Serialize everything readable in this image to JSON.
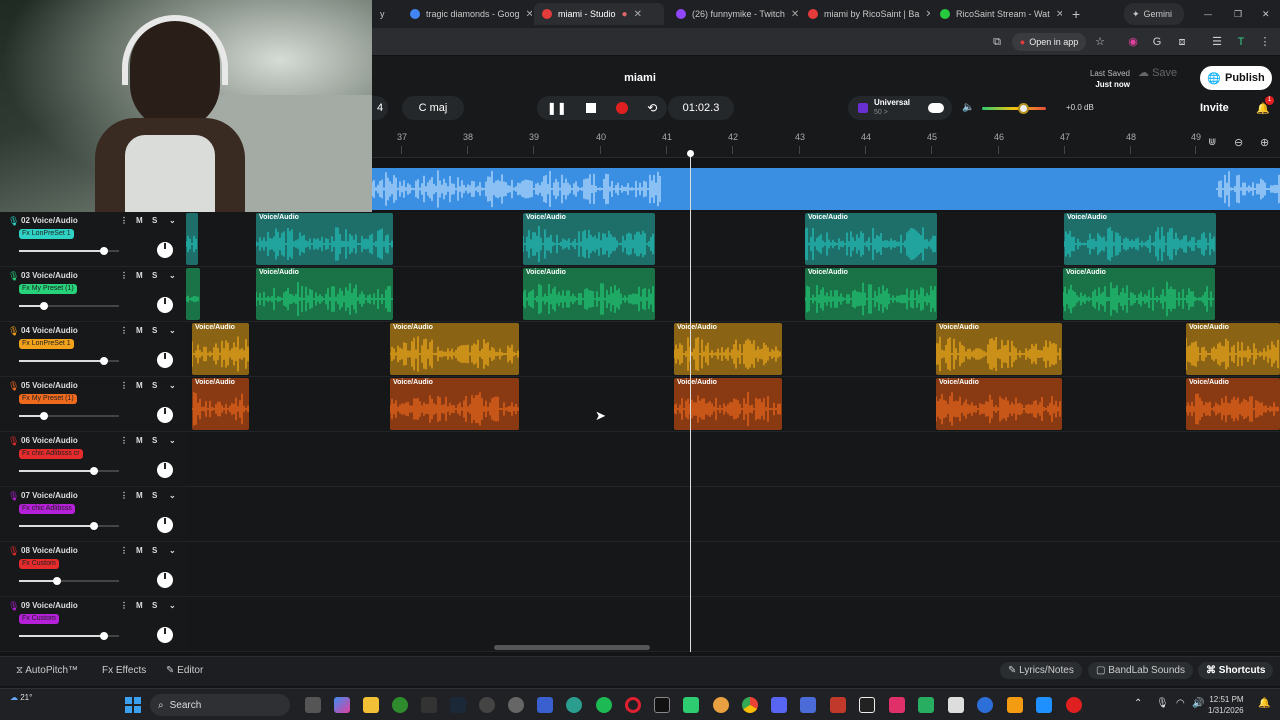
{
  "browser": {
    "tabs": [
      {
        "title": "tragic diamonds - Goog",
        "color": "#4285f4"
      },
      {
        "title": "miami - Studio",
        "color": "#e43b3b",
        "active": true
      },
      {
        "title": "(26) funnymike - Twitch",
        "color": "#9146ff"
      },
      {
        "title": "miami by RicoSaint | Ba",
        "color": "#e43b3b"
      },
      {
        "title": "RicoSaint Stream - Wat",
        "color": "#27c93f"
      }
    ],
    "gemini_label": "Gemini",
    "open_in_app": "Open in app"
  },
  "studio": {
    "song_title": "miami",
    "bar_display": "4",
    "key": "C maj",
    "time": "01:02.3",
    "preset_name": "Universal",
    "preset_value": "50 >",
    "volume_db": "+0.0 dB",
    "last_saved_label": "Last Saved",
    "last_saved_value": "Just now",
    "save_label": "Save",
    "publish_label": "Publish",
    "invite_label": "Invite",
    "notification_count": "1"
  },
  "ruler": {
    "ticks": [
      "37",
      "38",
      "39",
      "40",
      "41",
      "42",
      "43",
      "44",
      "45",
      "46",
      "47",
      "48",
      "49"
    ]
  },
  "tracks": [
    {
      "name": "02 Voice/Audio",
      "fx": "Fx LonPreSet 1",
      "fx_color": "#2fd3c6",
      "icon_color": "#2fd3c6",
      "clip_color": "#23c7bf",
      "clip_bg": "#1e6f6a",
      "volume": 0.85,
      "clips": [
        {
          "label": "Voice/Audio"
        },
        {
          "label": "Voice/Audio"
        },
        {
          "label": "Voice/Audio"
        },
        {
          "label": "Voice/Audio"
        }
      ]
    },
    {
      "name": "03 Voice/Audio",
      "fx": "Fx My Preset (1)",
      "fx_color": "#26d27a",
      "icon_color": "#26d27a",
      "clip_color": "#22cf78",
      "clip_bg": "#1a7346",
      "volume": 0.25,
      "clips": [
        {
          "label": "Voice/Audio"
        },
        {
          "label": "Voice/Audio"
        },
        {
          "label": "Voice/Audio"
        },
        {
          "label": "Voice/Audio"
        }
      ]
    },
    {
      "name": "04 Voice/Audio",
      "fx": "Fx LonPreSet 1",
      "fx_color": "#f2a21a",
      "icon_color": "#f2a21a",
      "clip_color": "#f4ad1c",
      "clip_bg": "#8a6414",
      "volume": 0.85,
      "clips": [
        {
          "label": "Voice/Audio"
        },
        {
          "label": "Voice/Audio"
        },
        {
          "label": "Voice/Audio"
        },
        {
          "label": "Voice/Audio"
        },
        {
          "label": "Voice/Audio"
        }
      ]
    },
    {
      "name": "05 Voice/Audio",
      "fx": "Fx My Preset (1)",
      "fx_color": "#f06a1e",
      "icon_color": "#f06a1e",
      "clip_color": "#f06a1e",
      "clip_bg": "#8a3a12",
      "volume": 0.25,
      "clips": [
        {
          "label": "Voice/Audio"
        },
        {
          "label": "Voice/Audio"
        },
        {
          "label": "Voice/Audio"
        },
        {
          "label": "Voice/Audio"
        },
        {
          "label": "Voice/Audio"
        }
      ]
    },
    {
      "name": "06 Voice/Audio",
      "fx": "Fx chic Adlibsss cr",
      "fx_color": "#e52b2b",
      "icon_color": "#e52b2b",
      "volume": 0.75,
      "clips": []
    },
    {
      "name": "07 Voice/Audio",
      "fx": "Fx chic Adlibsss",
      "fx_color": "#b620d8",
      "icon_color": "#b620d8",
      "volume": 0.75,
      "clips": []
    },
    {
      "name": "08 Voice/Audio",
      "fx": "Fx Custom",
      "fx_color": "#e52b2b",
      "icon_color": "#e52b2b",
      "volume": 0.38,
      "clips": []
    },
    {
      "name": "09 Voice/Audio",
      "fx": "Fx Custom",
      "fx_color": "#b620d8",
      "icon_color": "#b620d8",
      "volume": 0.85,
      "clips": []
    }
  ],
  "bottom": {
    "autopitch": "AutoPitch™",
    "effects": "Effects",
    "editor": "Editor",
    "lyrics": "Lyrics/Notes",
    "bandlab_sounds": "BandLab Sounds",
    "shortcuts": "Shortcuts"
  },
  "taskbar": {
    "weather": "21°",
    "search_placeholder": "Search",
    "time": "12:51 PM",
    "date": "1/31/2026"
  }
}
